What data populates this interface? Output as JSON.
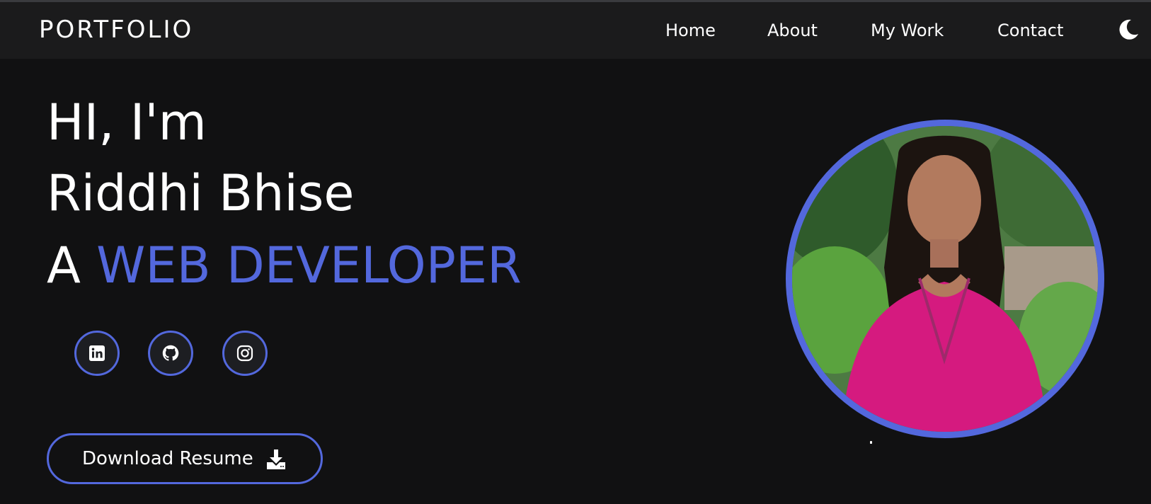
{
  "header": {
    "brand": "PORTFOLIO",
    "nav": [
      {
        "label": "Home"
      },
      {
        "label": "About"
      },
      {
        "label": "My Work"
      },
      {
        "label": "Contact"
      }
    ],
    "theme_toggle_icon": "moon-icon"
  },
  "hero": {
    "greeting": "HI, I'm",
    "name": "Riddhi Bhise",
    "role_prefix": "A",
    "role": "WEB DEVELOPER",
    "socials": [
      {
        "icon": "linkedin-icon"
      },
      {
        "icon": "github-icon"
      },
      {
        "icon": "instagram-icon"
      }
    ],
    "resume_button": {
      "label": "Download Resume",
      "icon": "download-icon"
    }
  },
  "colors": {
    "accent": "#5368dd",
    "background": "#111112",
    "navbar": "#1b1b1c",
    "text": "#ffffff"
  }
}
